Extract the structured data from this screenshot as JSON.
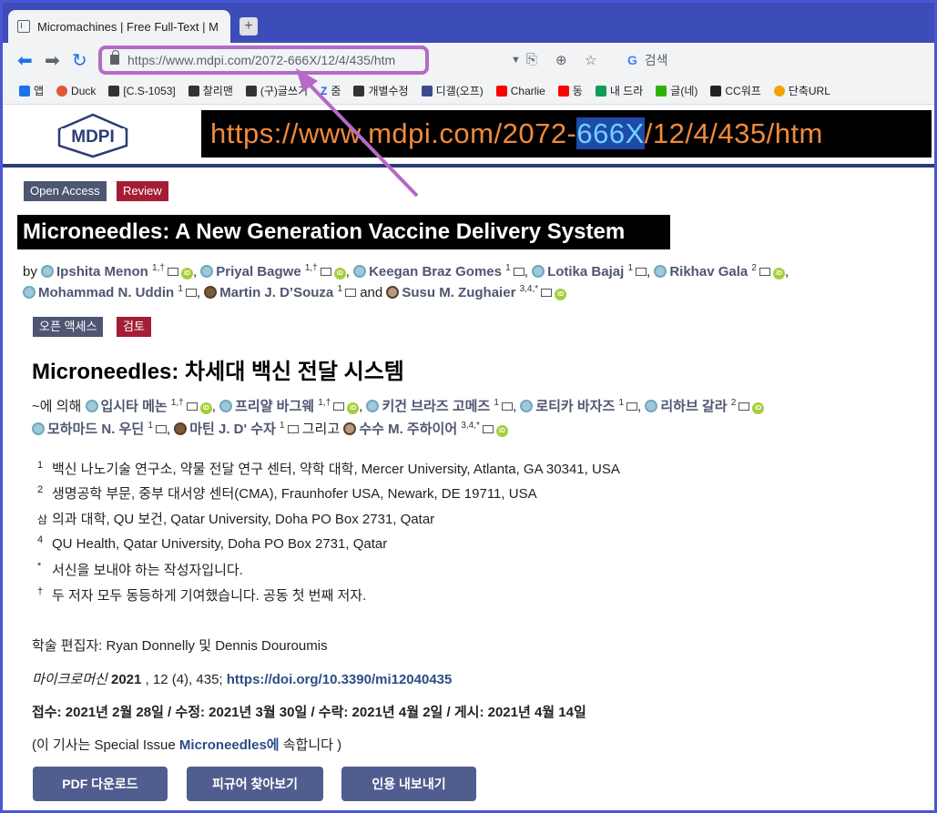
{
  "browser": {
    "tab_title": "Micromachines | Free Full-Text | M",
    "url": "https://www.mdpi.com/2072-666X/12/4/435/htm",
    "search_placeholder": "검색",
    "bookmarks": [
      "앱",
      "Duck",
      "[C.S-1053]",
      "찰리맨",
      "(구)글쓰기",
      "줌",
      "개별수정",
      "디갤(오프)",
      "Charlie",
      "동",
      "내 드라",
      "글(네)",
      "CC워프",
      "단축URL"
    ]
  },
  "header": {
    "logo_text": "MDPI",
    "big_url_prefix": "https://www.mdpi.com/2072-",
    "big_url_highlight": "666X",
    "big_url_suffix": "/12/4/435/htm"
  },
  "english": {
    "badge_open_access": "Open Access",
    "badge_review": "Review",
    "title": "Microneedles: A New Generation Vaccine Delivery System",
    "by": "by",
    "and": "and",
    "authors": [
      {
        "name": "Ipshita Menon",
        "sup": "1,†"
      },
      {
        "name": "Priyal Bagwe",
        "sup": "1,†"
      },
      {
        "name": "Keegan Braz Gomes",
        "sup": "1"
      },
      {
        "name": "Lotika Bajaj",
        "sup": "1"
      },
      {
        "name": "Rikhav Gala",
        "sup": "2"
      },
      {
        "name": "Mohammad N. Uddin",
        "sup": "1"
      },
      {
        "name": "Martin J. D’Souza",
        "sup": "1"
      },
      {
        "name": "Susu M. Zughaier",
        "sup": "3,4,*"
      }
    ]
  },
  "korean": {
    "badge_open_access": "오픈 액세스",
    "badge_review": "검토",
    "title": "Microneedles: 차세대 백신 전달 시스템",
    "by": "~에 의해",
    "and": "그리고",
    "authors": [
      {
        "name": "입시타 메논",
        "sup": "1,†"
      },
      {
        "name": "프리얄 바그웨",
        "sup": "1,†"
      },
      {
        "name": "키건 브라즈 고메즈",
        "sup": "1"
      },
      {
        "name": "로티카 바자즈",
        "sup": "1"
      },
      {
        "name": "리하브 갈라",
        "sup": "2"
      },
      {
        "name": "모하마드 N. 우딘",
        "sup": "1"
      },
      {
        "name": "마틴 J. D' 수자",
        "sup": "1"
      },
      {
        "name": "수수 M. 주하이어",
        "sup": "3,4,*"
      }
    ],
    "affiliations": [
      {
        "n": "1",
        "text": "백신 나노기술 연구소, 약물 전달 연구 센터, 약학 대학, Mercer University, Atlanta, GA 30341, USA"
      },
      {
        "n": "2",
        "text": "생명공학 부문, 중부 대서양 센터(CMA), Fraunhofer USA, Newark, DE 19711, USA"
      },
      {
        "n": "삼",
        "text": "의과 대학, QU 보건, Qatar University, Doha PO Box 2731, Qatar"
      },
      {
        "n": "4",
        "text": "QU Health, Qatar University, Doha PO Box 2731, Qatar"
      },
      {
        "n": "*",
        "text": "서신을 보내야 하는 작성자입니다."
      },
      {
        "n": "†",
        "text": "두 저자 모두 동등하게 기여했습니다. 공동 첫 번째 저자."
      }
    ],
    "editor": "학술 편집자: Ryan Donnelly 및 Dennis Douroumis",
    "journal": "마이크로머신",
    "year": "2021",
    "volume_issue": " , 12 (4), 435;",
    "doi": "https://doi.org/10.3390/mi12040435",
    "dates": "접수: 2021년 2월 28일 / 수정: 2021년 3월 30일 / 수락: 2021년 4월 2일 / 게시: 2021년 4월 14일",
    "special_prefix": "(이 기사는 Special Issue ",
    "special_link": "Microneedles에",
    "special_suffix": " 속합니다 )",
    "btn_pdf": "PDF 다운로드",
    "btn_figures": "피규어 찾아보기",
    "btn_cite": "인용 내보내기"
  },
  "colors": {
    "accent": "#4f5671",
    "review": "#a31e35",
    "annotation": "#b56ac7",
    "big_url_text": "#f08a3a"
  }
}
